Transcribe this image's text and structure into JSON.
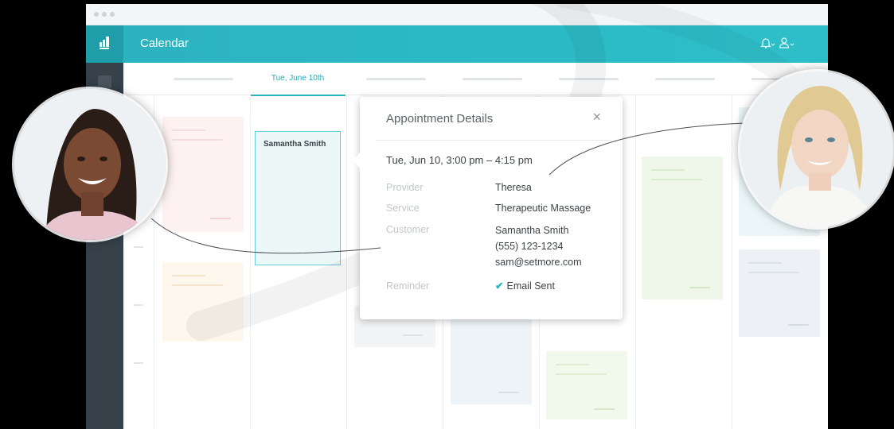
{
  "app": {
    "title": "Calendar",
    "brand_color": "#2bb3bf"
  },
  "header_icons": [
    "bell-icon",
    "chevron-down-icon",
    "user-icon",
    "chevron-down-icon"
  ],
  "calendar": {
    "active_day": "Tue, June 10th"
  },
  "appointment_block": {
    "customer": "Samantha Smith"
  },
  "details": {
    "title": "Appointment Details",
    "close": "×",
    "when": "Tue, Jun 10,  3:00 pm  – 4:15 pm",
    "provider_label": "Provider",
    "provider": "Theresa",
    "service_label": "Service",
    "service": "Therapeutic Massage",
    "customer_label": "Customer",
    "customer_name": "Samantha Smith",
    "customer_phone": "(555) 123-1234",
    "customer_email": "sam@setmore.com",
    "reminder_label": "Reminder",
    "reminder_check": "✔",
    "reminder": "Email Sent"
  }
}
